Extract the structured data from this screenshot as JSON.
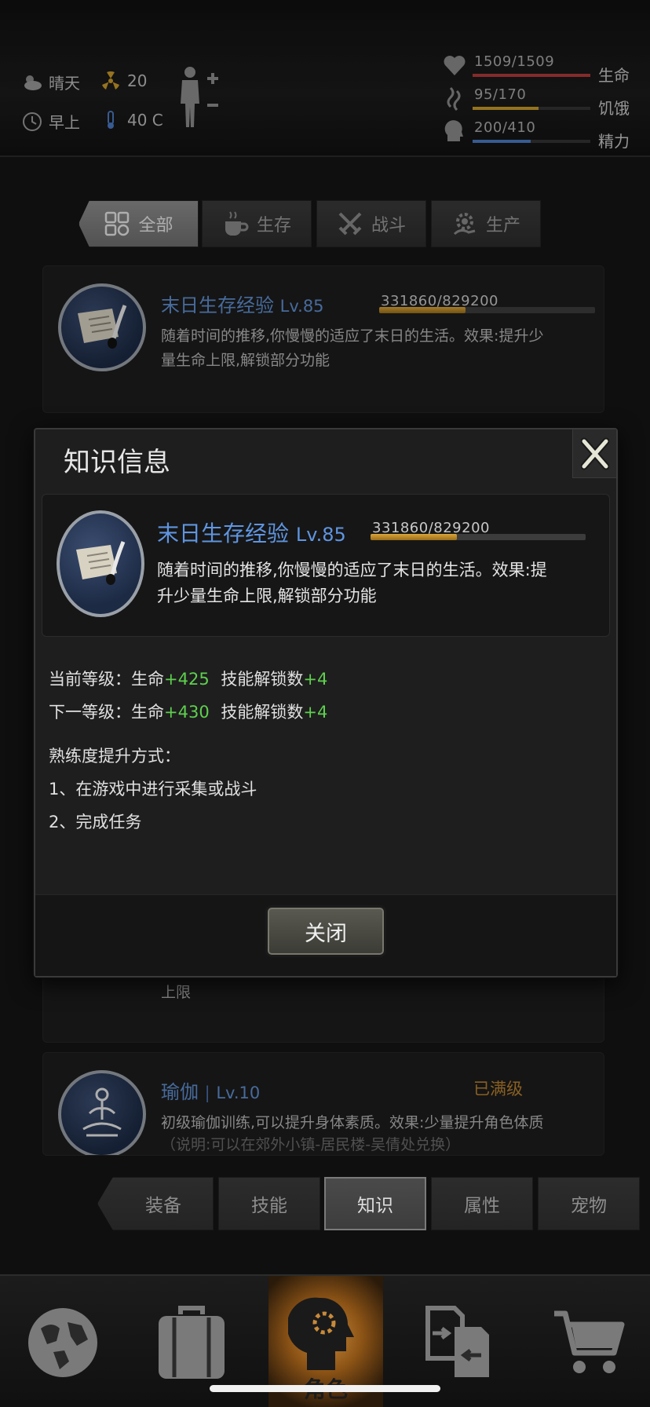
{
  "status": {
    "weather": "晴天",
    "radiation": "20",
    "time_of_day": "早上",
    "temperature": "40 C"
  },
  "vitals": [
    {
      "name": "life",
      "value": "1509/1509",
      "label": "生命",
      "color": "#b23a3a",
      "fraction": 1.0
    },
    {
      "name": "hunger",
      "value": "95/170",
      "label": "饥饿",
      "color": "#c79a2a",
      "fraction": 0.56
    },
    {
      "name": "energy",
      "value": "200/410",
      "label": "精力",
      "color": "#4a7ac2",
      "fraction": 0.49
    }
  ],
  "category_tabs": [
    {
      "label": "全部",
      "icon": "grid-icon"
    },
    {
      "label": "生存",
      "icon": "cup-icon"
    },
    {
      "label": "战斗",
      "icon": "crossed-swords-icon"
    },
    {
      "label": "生产",
      "icon": "gear-hand-icon"
    }
  ],
  "cards": {
    "top": {
      "title": "末日生存经验",
      "level": "Lv.85",
      "xp": "331860/829200",
      "xp_fraction": 0.4,
      "desc_line1": "随着时间的推移,你慢慢的适应了末日的生活。效果:提升少",
      "desc_line2": "量生命上限,解锁部分功能"
    },
    "middle_peek": "上限",
    "yoga": {
      "title": "瑜伽",
      "level": "Lv.10",
      "status": "已满级",
      "desc": "初级瑜伽训练,可以提升身体素质。效果:少量提升角色体质",
      "note": "（说明:可以在郊外小镇-居民楼-吴倩处兑换）"
    }
  },
  "modal": {
    "title": "知识信息",
    "skill": {
      "title": "末日生存经验",
      "level": "Lv.85",
      "xp": "331860/829200",
      "xp_fraction": 0.4,
      "desc_line1": "随着时间的推移,你慢慢的适应了末日的生活。效果:提",
      "desc_line2": "升少量生命上限,解锁部分功能"
    },
    "current_label": "当前等级：生命",
    "current_life": "+425",
    "current_skill_label": "技能解锁数",
    "current_skill": "+4",
    "next_label": "下一等级：生命",
    "next_life": "+430",
    "next_skill_label": "技能解锁数",
    "next_skill": "+4",
    "method_title": "熟练度提升方式：",
    "method_1": "1、在游戏中进行采集或战斗",
    "method_2": "2、完成任务",
    "close_button": "关闭"
  },
  "sub_tabs": [
    "装备",
    "技能",
    "知识",
    "属性",
    "宠物"
  ],
  "bottom_nav": {
    "active_label": "角色",
    "items": [
      "map-icon",
      "backpack-icon",
      "character-icon",
      "trade-icon",
      "cart-icon"
    ]
  }
}
